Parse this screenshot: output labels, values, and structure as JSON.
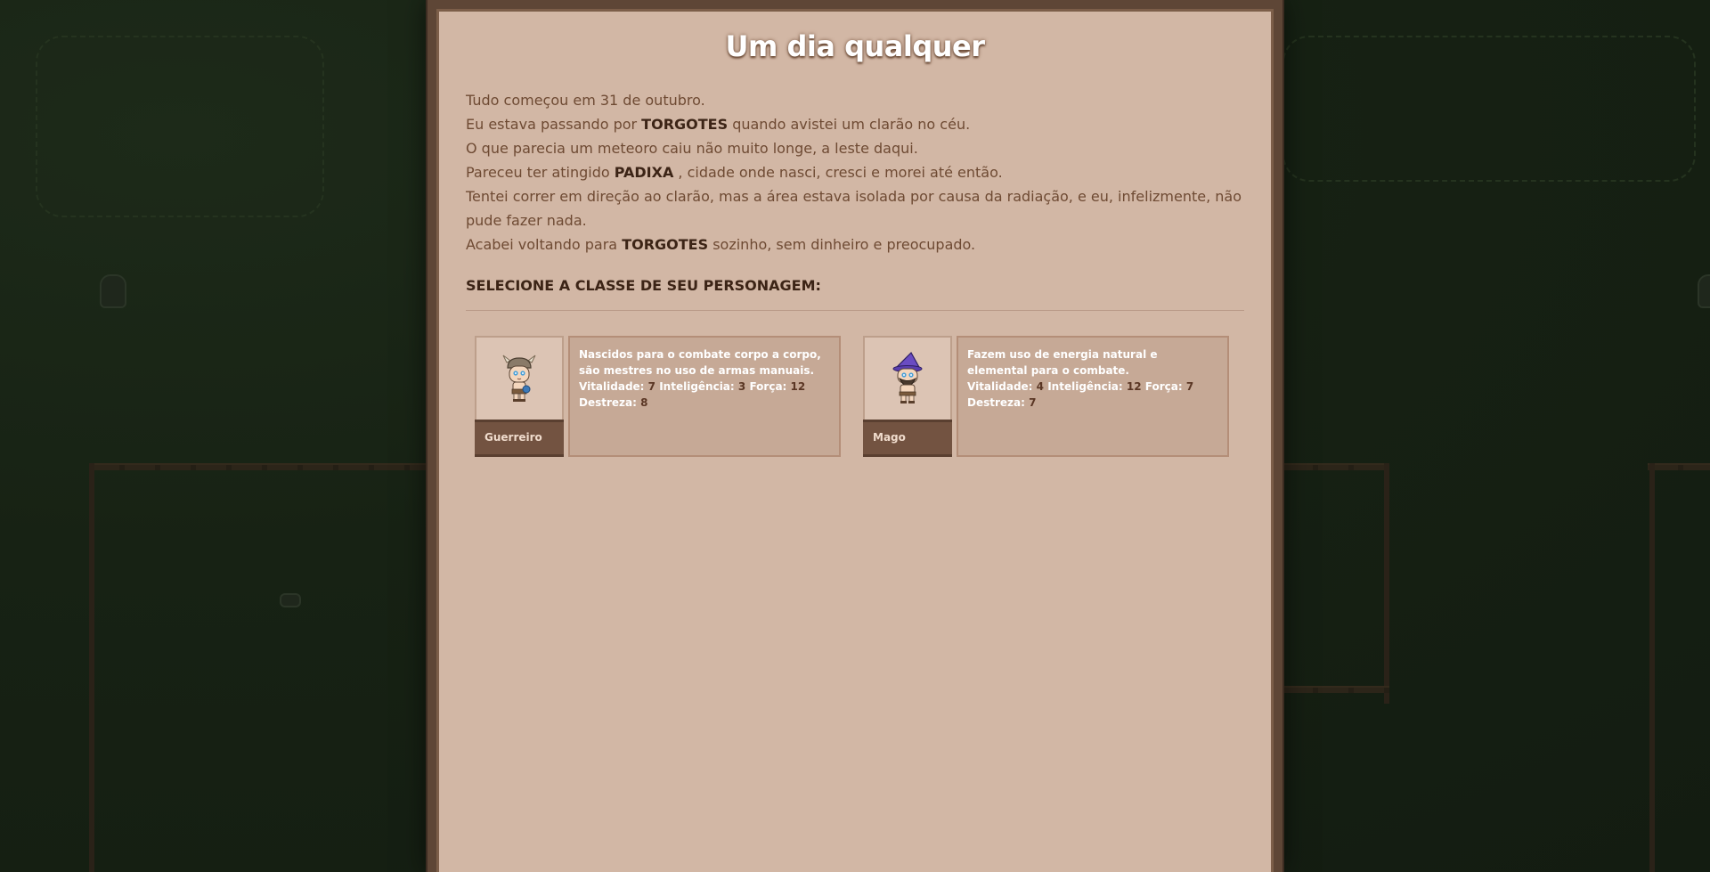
{
  "title": "Um dia qualquer",
  "story": {
    "line1": "Tudo começou em 31 de outubro.",
    "line2_pre": "Eu estava passando por ",
    "line2_bold": "TORGOTES",
    "line2_post": " quando avistei um clarão no céu.",
    "line3": "O que parecia um meteoro caiu não muito longe, a leste daqui.",
    "line4_pre": "Pareceu ter atingido ",
    "line4_bold": "PADIXA",
    "line4_post": " , cidade onde nasci, cresci e morei até então.",
    "line5": "Tentei correr em direção ao clarão, mas a área estava isolada por causa da radiação, e eu, infelizmente, não pude fazer nada.",
    "line6_pre": "Acabei voltando para ",
    "line6_bold": "TORGOTES",
    "line6_post": " sozinho, sem dinheiro e preocupado."
  },
  "select_label": "SELECIONE A CLASSE DE SEU PERSONAGEM:",
  "classes": [
    {
      "name": "Guerreiro",
      "description": "Nascidos para o combate corpo a corpo, são mestres no uso de armas manuais.",
      "stats": {
        "vit_label": "Vitalidade:",
        "vit": "7",
        "int_label": "Inteligência:",
        "int": "3",
        "str_label": "Força:",
        "str": "12",
        "dex_label": "Destreza:",
        "dex": "8"
      }
    },
    {
      "name": "Mago",
      "description": "Fazem uso de energia natural e elemental para o combate.",
      "stats": {
        "vit_label": "Vitalidade:",
        "vit": "4",
        "int_label": "Inteligência:",
        "int": "12",
        "str_label": "Força:",
        "str": "7",
        "dex_label": "Destreza:",
        "dex": "7"
      }
    }
  ],
  "colors": {
    "modal_frame": "#5e4636",
    "modal_bg": "#d2b7a5",
    "text": "#6e4a33",
    "bold_text": "#3c2416",
    "class_label_bg": "#735341"
  }
}
